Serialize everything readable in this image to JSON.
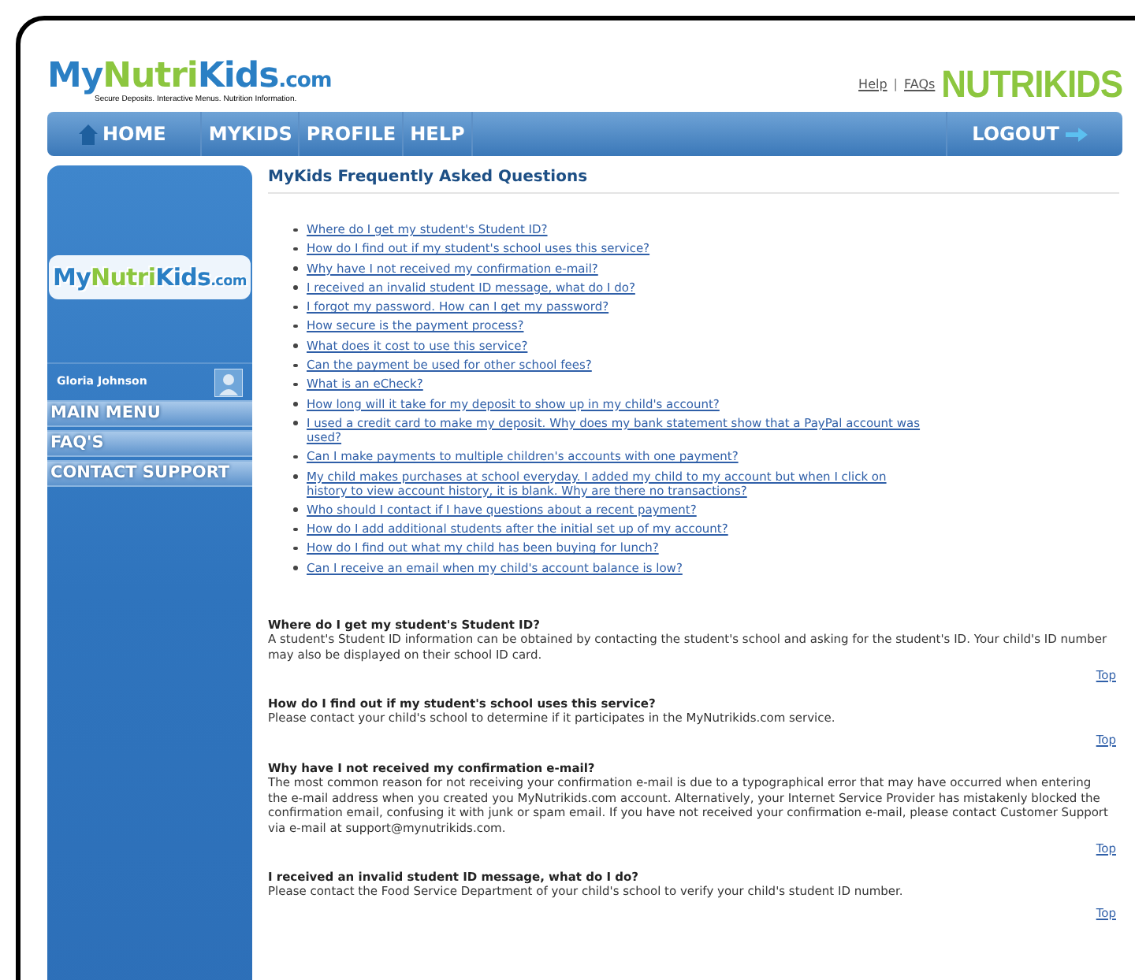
{
  "header": {
    "logo": "MyNutriKids.com",
    "tagline": "Secure Deposits. Interactive Menus. Nutrition Information.",
    "links": [
      "Help",
      "FAQs"
    ],
    "separator": "|",
    "brand": "NUTRIKIDS"
  },
  "nav": {
    "items": [
      {
        "label": "HOME"
      },
      {
        "label": "MYKIDS"
      },
      {
        "label": "PROFILE"
      },
      {
        "label": "HELP"
      }
    ],
    "logout": "LOGOUT"
  },
  "sidebar": {
    "logo": "MyNutriKids.com",
    "user": "Gloria Johnson",
    "menu": [
      "MAIN MENU",
      "FAQ'S",
      "CONTACT SUPPORT"
    ]
  },
  "page_title": "MyKids Frequently Asked Questions",
  "questions": [
    "Where do I get my student's Student ID?",
    "How do I find out if my student's school uses this service?",
    "Why have I not received my confirmation e-mail?",
    "I received an invalid student ID message, what do I do?",
    "I forgot my password. How can I get my password?",
    "How secure is the payment process?",
    "What does it cost to use this service?",
    "Can the payment be used for other school fees?",
    "What is an eCheck?",
    "How long will it take for my deposit to show up in my child's account?",
    "I used a credit card to make my deposit. Why does my bank statement show that a PayPal account was used?",
    "Can I make payments to multiple children's accounts with one payment?",
    "My child makes purchases at school everyday. I added my child to my account but when I click on history to view account history, it is blank. Why are there no transactions?",
    "Who should I contact if I have questions about a recent payment?",
    "How do I add additional students after the initial set up of my account?",
    "How do I find out what my child has been buying for lunch?",
    "Can I receive an email when my child's account balance is low?"
  ],
  "answers": [
    {
      "question": "Where do I get my student's Student ID?",
      "answer": "A student's Student ID information can be obtained by contacting the student's school and asking for the student's ID. Your child's ID number may also be displayed on their school ID card.",
      "top": "Top"
    },
    {
      "question": "How do I find out if my student's school uses this service?",
      "answer": "Please contact your child's school to determine if it participates in the MyNutrikids.com service.",
      "top": "Top"
    },
    {
      "question": "Why have I not received my confirmation e-mail?",
      "answer": "The most common reason for not receiving your confirmation e-mail is due to a typographical error that may have occurred when entering the e-mail address when you created you MyNutrikids.com account. Alternatively, your Internet Service Provider has mistakenly blocked the confirmation email, confusing it with junk or spam email. If you have not received your confirmation e-mail, please contact Customer Support via e-mail at support@mynutrikids.com.",
      "top": "Top"
    },
    {
      "question": "I received an invalid student ID message, what do I do?",
      "answer": "Please contact the Food Service Department of your child's school to verify your child's student ID number.",
      "top": "Top"
    }
  ]
}
